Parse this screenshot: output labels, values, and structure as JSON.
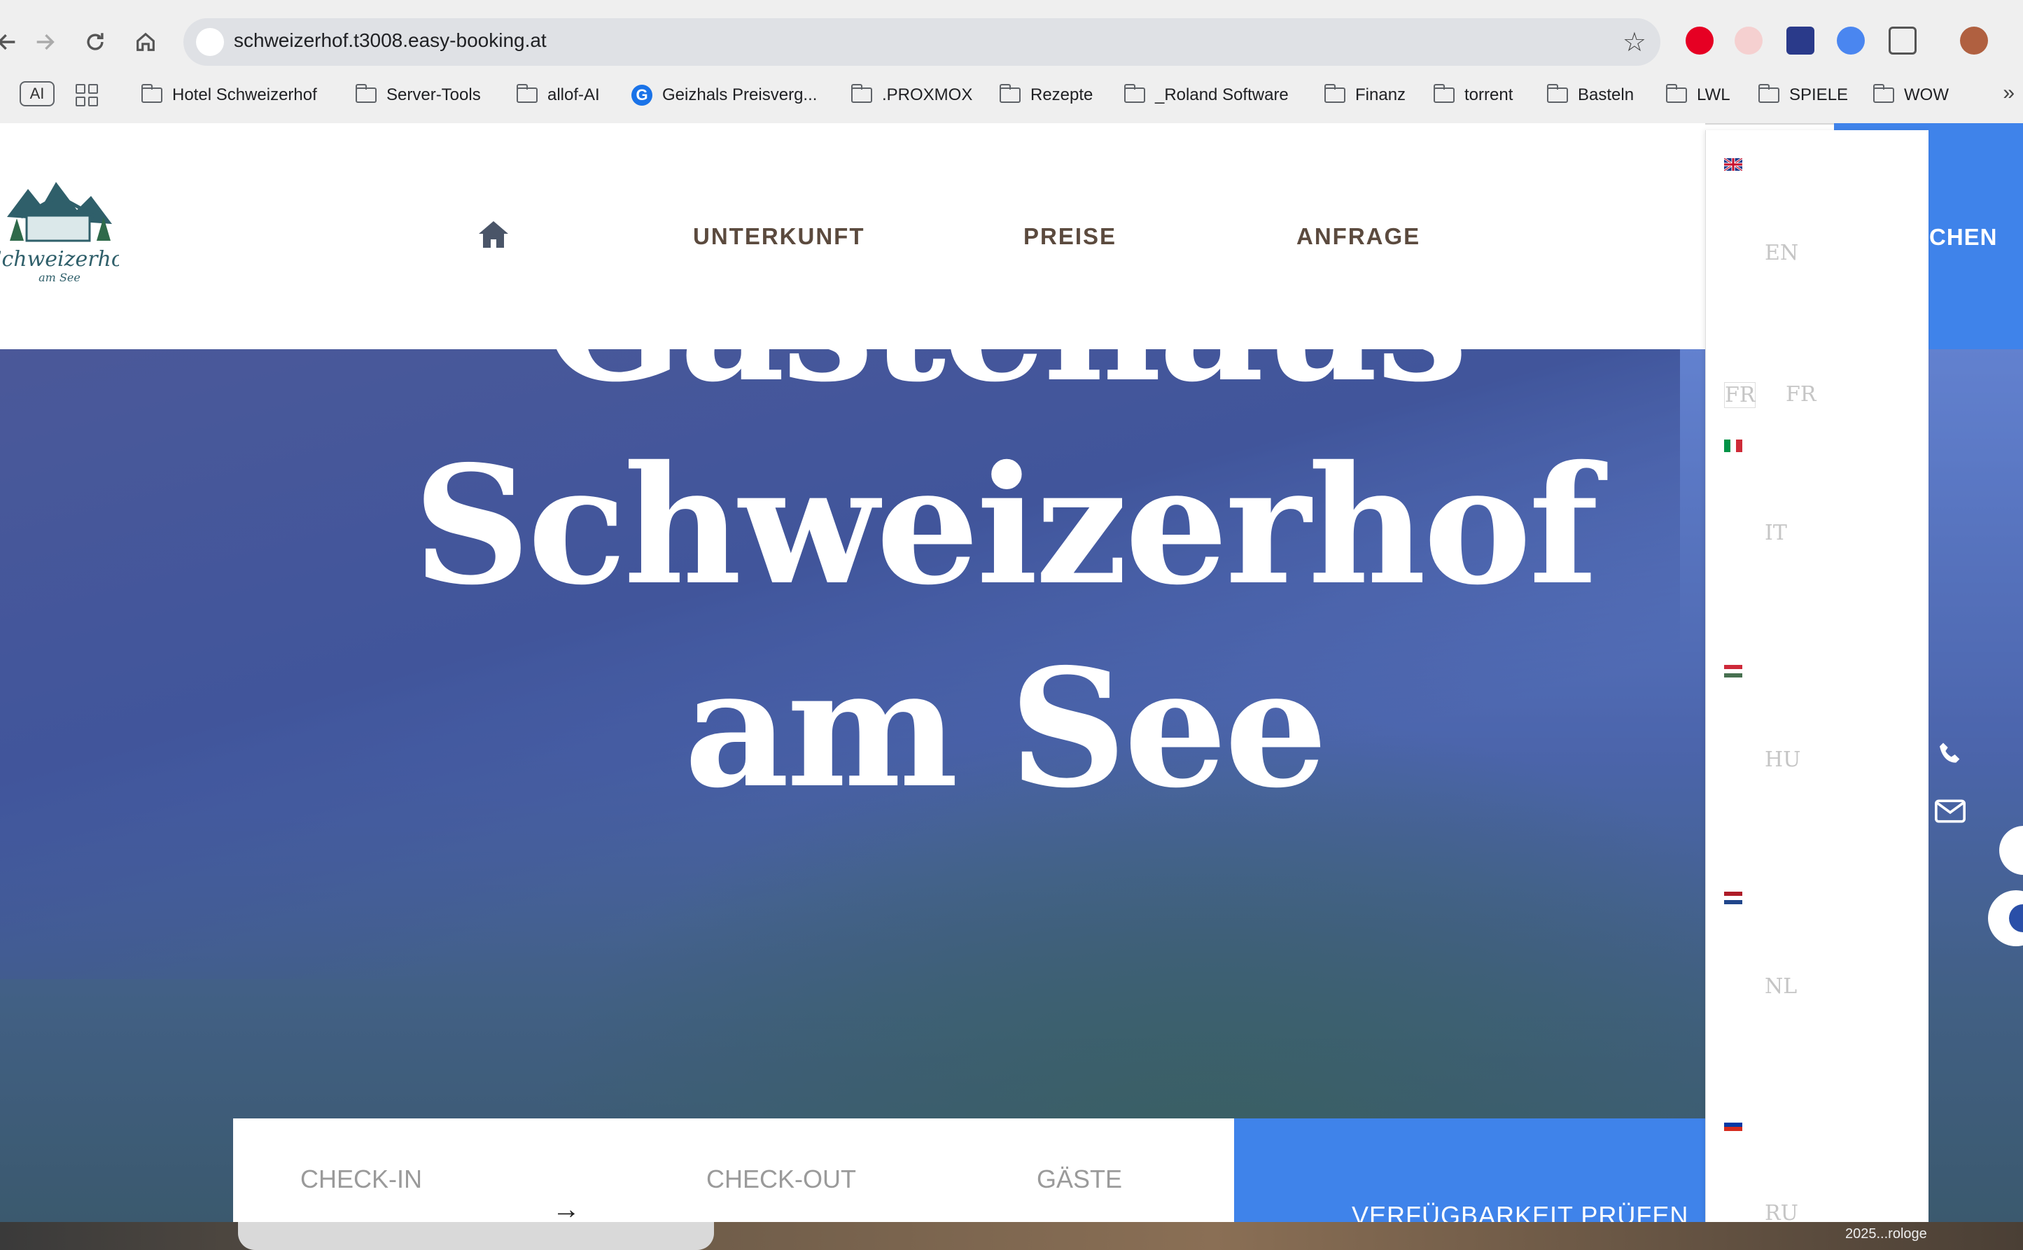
{
  "browser": {
    "url": "schweizerhof.t3008.easy-booking.at",
    "ai_chip": "AI",
    "bookmarks": [
      {
        "label": "Hotel Schweizerhof",
        "icon": "folder-icon"
      },
      {
        "label": "Server-Tools",
        "icon": "folder-icon"
      },
      {
        "label": "allof-AI",
        "icon": "folder-icon"
      },
      {
        "label": "Geizhals Preisverg...",
        "icon": "g-icon"
      },
      {
        "label": ".PROXMOX",
        "icon": "folder-icon"
      },
      {
        "label": "Rezepte",
        "icon": "folder-icon"
      },
      {
        "label": "_Roland Software",
        "icon": "folder-icon"
      },
      {
        "label": "Finanz",
        "icon": "folder-icon"
      },
      {
        "label": "torrent",
        "icon": "folder-icon"
      },
      {
        "label": "Basteln",
        "icon": "folder-icon"
      },
      {
        "label": "LWL",
        "icon": "folder-icon"
      },
      {
        "label": "SPIELE",
        "icon": "folder-icon"
      },
      {
        "label": "WOW",
        "icon": "folder-icon"
      }
    ],
    "more_glyph": "»",
    "g_letter": "G"
  },
  "site": {
    "logo_text_1": "Schweizerhof",
    "logo_text_2": "am See",
    "menu": {
      "unterkunft": "UNTERKUNFT",
      "preise": "PREISE",
      "anfrage": "ANFRAGE"
    },
    "book_label": "CHEN",
    "hero_title": "Gästehaus Schweizerhof am See",
    "booking": {
      "checkin": "CHECK-IN",
      "checkout": "CHECK-OUT",
      "guests": "GÄSTE",
      "cta": "VERFÜGBARKEIT PRÜFEN"
    },
    "languages": [
      {
        "code": "EN"
      },
      {
        "code": "FR",
        "broken_alt": "FR"
      },
      {
        "code": "IT"
      },
      {
        "code": "HU"
      },
      {
        "code": "NL"
      },
      {
        "code": "RU"
      }
    ]
  },
  "dock": {
    "label": "2025...rologe"
  },
  "colors": {
    "accent": "#3f83ea",
    "menu_text": "#5b4a3e"
  }
}
